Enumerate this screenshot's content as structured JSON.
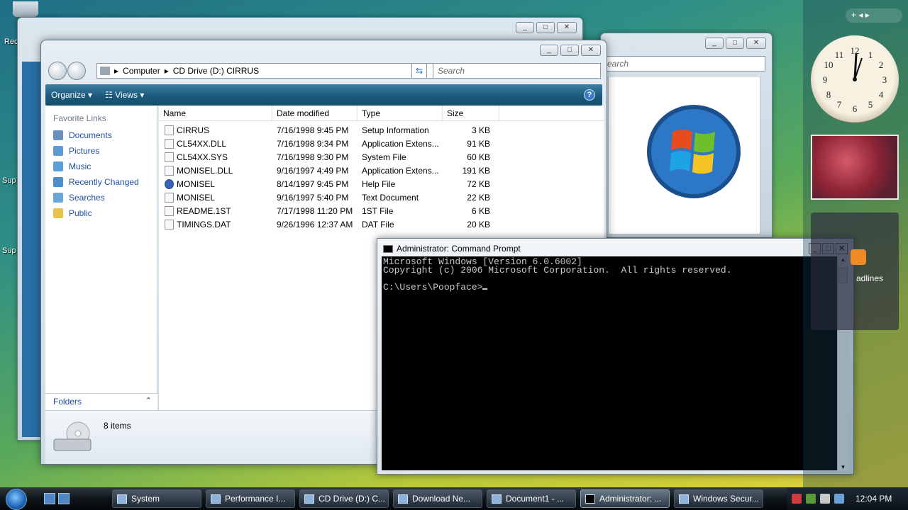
{
  "desktop": {
    "label_rec": "Rec",
    "label_sup1": "Sup",
    "label_sup2": "Sup"
  },
  "explorer": {
    "breadcrumb": [
      "Computer",
      "CD Drive (D:) CIRRUS"
    ],
    "search_placeholder": "Search",
    "toolbar": {
      "organize": "Organize",
      "views": "Views"
    },
    "nav": {
      "title": "Favorite Links",
      "items": [
        "Documents",
        "Pictures",
        "Music",
        "Recently Changed",
        "Searches",
        "Public"
      ],
      "folders": "Folders"
    },
    "columns": [
      "Name",
      "Date modified",
      "Type",
      "Size"
    ],
    "files": [
      {
        "name": "CIRRUS",
        "date": "7/16/1998 9:45 PM",
        "type": "Setup Information",
        "size": "3 KB"
      },
      {
        "name": "CL54XX.DLL",
        "date": "7/16/1998 9:34 PM",
        "type": "Application Extens...",
        "size": "91 KB"
      },
      {
        "name": "CL54XX.SYS",
        "date": "7/16/1998 9:30 PM",
        "type": "System File",
        "size": "60 KB"
      },
      {
        "name": "MONISEL.DLL",
        "date": "9/16/1997 4:49 PM",
        "type": "Application Extens...",
        "size": "191 KB"
      },
      {
        "name": "MONISEL",
        "date": "8/14/1997 9:45 PM",
        "type": "Help File",
        "size": "72 KB"
      },
      {
        "name": "MONISEL",
        "date": "9/16/1997 5:40 PM",
        "type": "Text Document",
        "size": "22 KB"
      },
      {
        "name": "README.1ST",
        "date": "7/17/1998 11:20 PM",
        "type": "1ST File",
        "size": "6 KB"
      },
      {
        "name": "TIMINGS.DAT",
        "date": "9/26/1996 12:37 AM",
        "type": "DAT File",
        "size": "20 KB"
      }
    ],
    "status": "8 items"
  },
  "bgwindow": {
    "search_placeholder": "earch"
  },
  "cmd": {
    "title": "Administrator: Command Prompt",
    "lines": [
      "Microsoft Windows [Version 6.0.6002]",
      "Copyright (c) 2006 Microsoft Corporation.  All rights reserved.",
      "",
      "C:\\Users\\Poopface>"
    ]
  },
  "gadgets": {
    "feeds_label": "adlines"
  },
  "taskbar": {
    "buttons": [
      "System",
      "Performance I...",
      "CD Drive (D:) C...",
      "Download Ne...",
      "Document1 - ...",
      "Administrator: ...",
      "Windows Secur..."
    ],
    "active_index": 5,
    "clock": "12:04 PM"
  }
}
